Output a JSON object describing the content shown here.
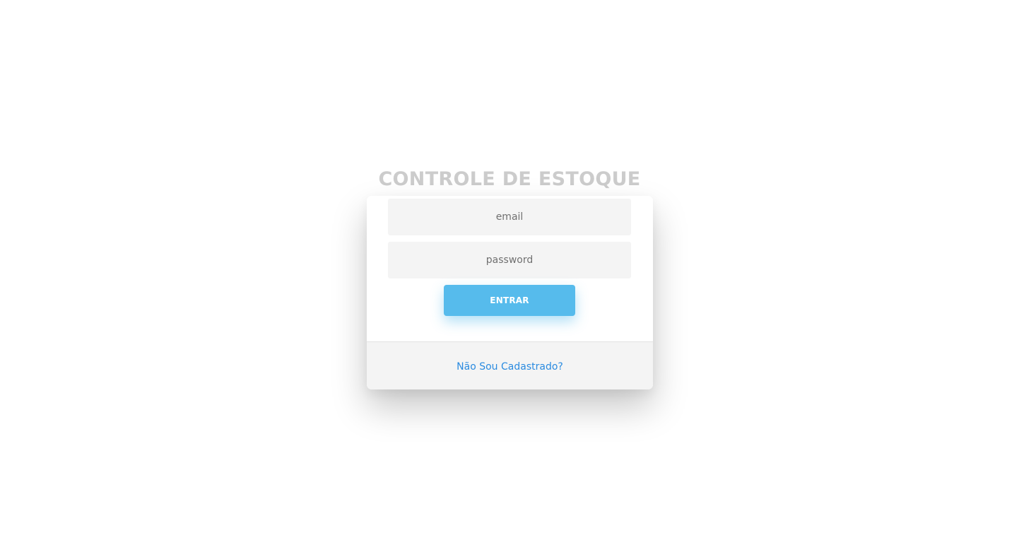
{
  "app": {
    "title": "CONTROLE DE ESTOQUE"
  },
  "login_form": {
    "email": {
      "placeholder": "email",
      "value": ""
    },
    "password": {
      "placeholder": "password",
      "value": ""
    },
    "submit_label": "ENTRAR"
  },
  "footer": {
    "register_link_label": "Não Sou Cadastrado?"
  },
  "colors": {
    "accent": "#56bbec",
    "link": "#2a8be0",
    "title": "#cccccc",
    "field_bg": "#f4f4f4"
  }
}
